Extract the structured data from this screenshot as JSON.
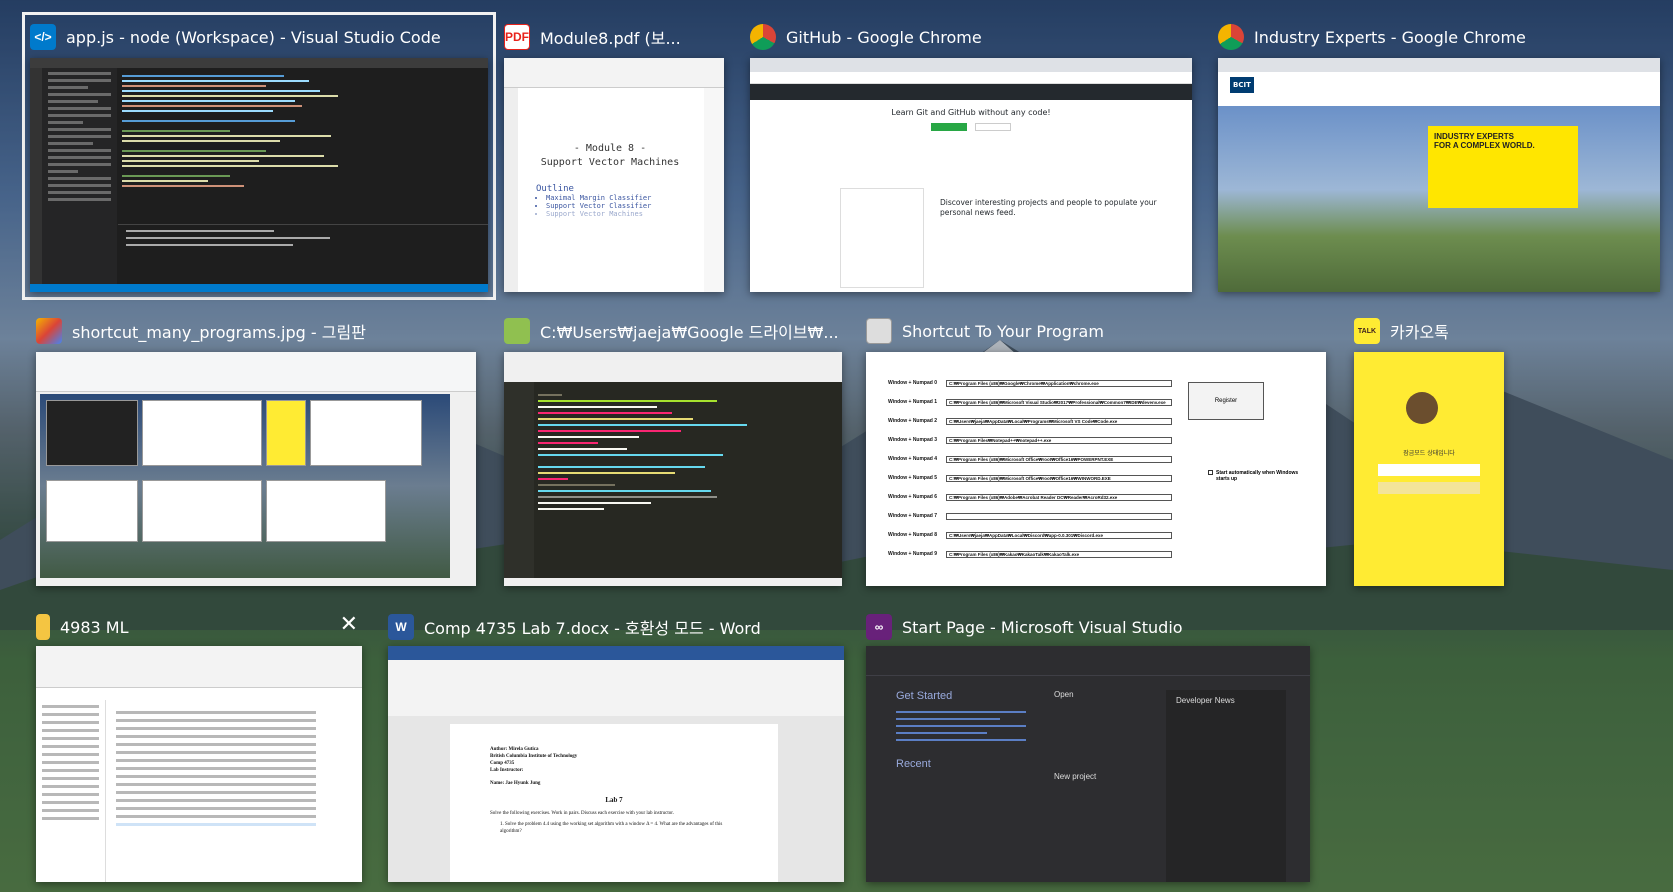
{
  "windows": {
    "vscode": {
      "title": "app.js - node (Workspace) - Visual Studio Code",
      "icon": "vscode-icon"
    },
    "pdf": {
      "title": "Module8.pdf (보...",
      "icon": "pdf-icon",
      "page_title_1": "- Module 8 -",
      "page_title_2": "Support Vector Machines",
      "outline": "Outline",
      "outline_items": [
        "Maximal Margin Classifier",
        "Support Vector Classifier",
        "Support Vector Machines"
      ]
    },
    "github": {
      "title": "GitHub - Google Chrome",
      "icon": "chrome-icon",
      "hero": "Learn Git and GitHub without any code!",
      "discover": "Discover interesting projects and people to populate your personal news feed."
    },
    "bcit": {
      "title": "Industry Experts - Google Chrome",
      "icon": "chrome-icon",
      "logo": "BCIT",
      "headline_1": "INDUSTRY EXPERTS",
      "headline_2": "FOR A COMPLEX WORLD."
    },
    "paint": {
      "title": "shortcut_many_programs.jpg - 그림판",
      "icon": "paint-icon"
    },
    "notepadpp": {
      "title": "C:₩Users₩jaeja₩Google 드라이브₩...",
      "icon": "notepadpp-icon"
    },
    "shortcut": {
      "title": "Shortcut To Your Program",
      "icon": "app-window-icon",
      "register": "Register",
      "startup": "Start automatically when Windows starts up",
      "rows": [
        {
          "key": "Window + Numpad 0",
          "path": "C:₩Program Files (x86)₩Google₩Chrome₩Application₩chrome.exe"
        },
        {
          "key": "Window + Numpad 1",
          "path": "C:₩Program Files (x86)₩Microsoft Visual Studio₩2017₩Professional₩Common7₩IDE₩devenv.exe"
        },
        {
          "key": "Window + Numpad 2",
          "path": "C:₩Users₩jaeja₩AppData₩Local₩Programs₩Microsoft VS Code₩Code.exe"
        },
        {
          "key": "Window + Numpad 3",
          "path": "C:₩Program Files₩Notepad++₩notepad++.exe"
        },
        {
          "key": "Window + Numpad 4",
          "path": "C:₩Program Files (x86)₩Microsoft Office₩root₩Office16₩POWERPNT.EXE"
        },
        {
          "key": "Window + Numpad 5",
          "path": "C:₩Program Files (x86)₩Microsoft Office₩root₩Office16₩WINWORD.EXE"
        },
        {
          "key": "Window + Numpad 6",
          "path": "C:₩Program Files (x86)₩Adobe₩Acrobat Reader DC₩Reader₩AcroRd32.exe"
        },
        {
          "key": "Window + Numpad 7",
          "path": ""
        },
        {
          "key": "Window + Numpad 8",
          "path": "C:₩Users₩jaeja₩AppData₩Local₩Discord₩app-0.0.301₩Discord.exe"
        },
        {
          "key": "Window + Numpad 9",
          "path": "C:₩Program Files (x86)₩Kakao₩KakaoTalk₩KakaoTalk.exe"
        }
      ]
    },
    "kakaotalk": {
      "title": "카카오톡",
      "icon": "kakaotalk-icon",
      "icon_text": "TALK",
      "prompt": "잠금모드 상태입니다"
    },
    "explorer": {
      "title": "4983 ML",
      "icon": "folder-icon",
      "close": "✕"
    },
    "word": {
      "title": "Comp 4735 Lab 7.docx  -  호환성 모드 - Word",
      "icon": "word-icon",
      "icon_text": "W",
      "doc_lines": [
        "Author: Mirela Gutica",
        "British Columbia Institute of Technology",
        "Comp 4735",
        "Lab Instructor:",
        "Name: Jae Hyunk Jung",
        "Lab 7",
        "Solve the following exercises. Work in pairs. Discuss each exercise with your lab instructor.",
        "1.  Solve the problem 4.4 using the working set algorithm with a window Δ = 4. What are the advantages of this algorithm?"
      ]
    },
    "visualstudio": {
      "title": "Start Page - Microsoft Visual Studio",
      "icon": "visualstudio-icon",
      "get_started": "Get Started",
      "recent": "Recent",
      "open": "Open",
      "new_project": "New project",
      "developer_news": "Developer News"
    }
  },
  "colors": {
    "vscode": "#007acc",
    "chrome_red": "#db4437",
    "word": "#2b579a",
    "kakao": "#ffeb33",
    "vs": "#68217a",
    "pdf": "#e8221b"
  }
}
